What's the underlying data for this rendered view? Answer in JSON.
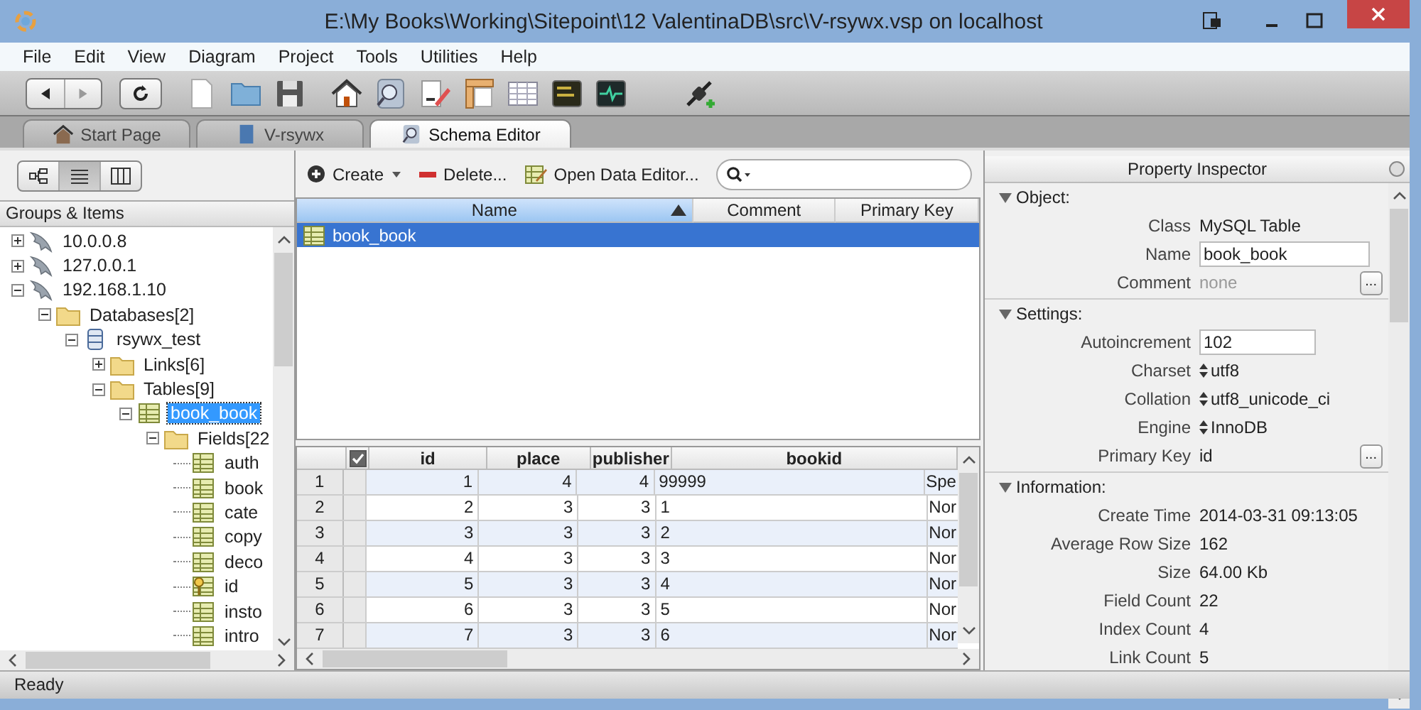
{
  "window": {
    "title": "E:\\My Books\\Working\\Sitepoint\\12 ValentinaDB\\src\\V-rsywx.vsp on localhost"
  },
  "menu": [
    "File",
    "Edit",
    "View",
    "Diagram",
    "Project",
    "Tools",
    "Utilities",
    "Help"
  ],
  "tabs": [
    {
      "label": "Start Page",
      "kind": "home",
      "selected": false
    },
    {
      "label": "V-rsywx",
      "kind": "project",
      "selected": false
    },
    {
      "label": "Schema Editor",
      "kind": "schema",
      "selected": true
    }
  ],
  "left_panel": {
    "view_modes": [
      {
        "kind": "diagram",
        "selected": false
      },
      {
        "kind": "list",
        "selected": true
      },
      {
        "kind": "columns",
        "selected": false
      }
    ],
    "header": "Groups & Items",
    "tree": [
      {
        "label": "10.0.0.8",
        "kind": "server",
        "expanded": false,
        "selected": false
      },
      {
        "label": "127.0.0.1",
        "kind": "server",
        "expanded": false,
        "selected": false
      },
      {
        "label": "192.168.1.10",
        "kind": "server",
        "expanded": true,
        "selected": false,
        "children": [
          {
            "label": "Databases[2]",
            "kind": "folder",
            "expanded": true,
            "selected": false,
            "children": [
              {
                "label": "rsywx_test",
                "kind": "database",
                "expanded": true,
                "selected": false,
                "children": [
                  {
                    "label": "Links[6]",
                    "kind": "folder",
                    "expanded": false,
                    "selected": false
                  },
                  {
                    "label": "Tables[9]",
                    "kind": "folder",
                    "expanded": true,
                    "selected": false,
                    "children": [
                      {
                        "label": "book_book",
                        "kind": "table",
                        "expanded": true,
                        "selected": true,
                        "children": [
                          {
                            "label": "Fields[22",
                            "kind": "folder",
                            "expanded": true,
                            "selected": false,
                            "children": [
                              {
                                "label": "auth",
                                "kind": "field",
                                "selected": false
                              },
                              {
                                "label": "book",
                                "kind": "field",
                                "selected": false
                              },
                              {
                                "label": "cate",
                                "kind": "field",
                                "selected": false
                              },
                              {
                                "label": "copy",
                                "kind": "field",
                                "selected": false
                              },
                              {
                                "label": "deco",
                                "kind": "field",
                                "selected": false
                              },
                              {
                                "label": "id",
                                "kind": "key",
                                "selected": false
                              },
                              {
                                "label": "insto",
                                "kind": "field",
                                "selected": false
                              },
                              {
                                "label": "intro",
                                "kind": "field",
                                "selected": false
                              }
                            ]
                          }
                        ]
                      }
                    ]
                  }
                ]
              }
            ]
          }
        ]
      }
    ]
  },
  "toolbar": {
    "create": "Create",
    "delete": "Delete...",
    "open_data_editor": "Open Data Editor..."
  },
  "objects_table": {
    "columns": [
      {
        "label": "Name",
        "sorted": true
      },
      {
        "label": "Comment",
        "sorted": false
      },
      {
        "label": "Primary Key",
        "sorted": false
      }
    ],
    "rows": [
      {
        "name": "book_book",
        "selected": true
      }
    ]
  },
  "data_grid": {
    "all_checked": true,
    "columns": [
      "id",
      "place",
      "publisher",
      "bookid"
    ],
    "rows": [
      {
        "number": "1",
        "id": "1",
        "place": "4",
        "publisher": "4",
        "bookid": "99999",
        "column_6": "Spe"
      },
      {
        "number": "2",
        "id": "2",
        "place": "3",
        "publisher": "3",
        "bookid": "1",
        "column_6": "Nor"
      },
      {
        "number": "3",
        "id": "3",
        "place": "3",
        "publisher": "3",
        "bookid": "2",
        "column_6": "Nor"
      },
      {
        "number": "4",
        "id": "4",
        "place": "3",
        "publisher": "3",
        "bookid": "3",
        "column_6": "Nor"
      },
      {
        "number": "5",
        "id": "5",
        "place": "3",
        "publisher": "3",
        "bookid": "4",
        "column_6": "Nor"
      },
      {
        "number": "6",
        "id": "6",
        "place": "3",
        "publisher": "3",
        "bookid": "5",
        "column_6": "Nor"
      },
      {
        "number": "7",
        "id": "7",
        "place": "3",
        "publisher": "3",
        "bookid": "6",
        "column_6": "Nor"
      }
    ]
  },
  "property_inspector": {
    "title": "Property Inspector",
    "sections": [
      {
        "title": "Object:",
        "expanded": true,
        "rows": [
          {
            "kind": "text",
            "label": "Class",
            "value": "MySQL Table",
            "disabled": false
          },
          {
            "kind": "input",
            "label": "Name",
            "value": "book_book",
            "disabled": false
          },
          {
            "kind": "text",
            "label": "Comment",
            "value": "none",
            "disabled": true,
            "button": "..."
          }
        ]
      },
      {
        "title": "Settings:",
        "expanded": true,
        "rows": [
          {
            "kind": "input",
            "label": "Autoincrement",
            "value": "102",
            "disabled": false
          },
          {
            "kind": "select",
            "label": "Charset",
            "value": "utf8",
            "disabled": false
          },
          {
            "kind": "select",
            "label": "Collation",
            "value": "utf8_unicode_ci",
            "disabled": false
          },
          {
            "kind": "select",
            "label": "Engine",
            "value": "InnoDB",
            "disabled": false
          },
          {
            "kind": "text",
            "label": "Primary Key",
            "value": "id",
            "disabled": false,
            "button": "..."
          }
        ]
      },
      {
        "title": "Information:",
        "expanded": true,
        "rows": [
          {
            "kind": "text",
            "label": "Create Time",
            "value": "2014-03-31 09:13:05",
            "disabled": false
          },
          {
            "kind": "text",
            "label": "Average Row Size",
            "value": "162",
            "disabled": false
          },
          {
            "kind": "text",
            "label": "Size",
            "value": "64.00 Kb",
            "disabled": false
          },
          {
            "kind": "text",
            "label": "Field Count",
            "value": "22",
            "disabled": false
          },
          {
            "kind": "text",
            "label": "Index Count",
            "value": "4",
            "disabled": false
          },
          {
            "kind": "text",
            "label": "Link Count",
            "value": "5",
            "disabled": false
          }
        ]
      }
    ]
  },
  "status_bar": "Ready"
}
